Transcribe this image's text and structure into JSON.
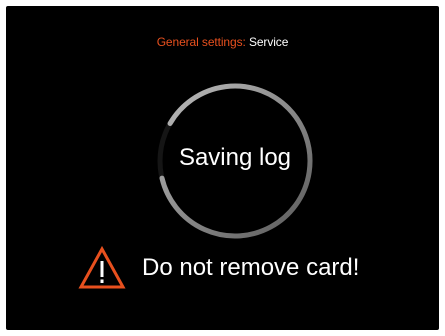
{
  "header": {
    "category": "General settings:",
    "subcategory": "Service"
  },
  "progress": {
    "label": "Saving log",
    "fraction": 0.88
  },
  "warning": {
    "icon": "warning-triangle-icon",
    "text": "Do not remove card!"
  },
  "colors": {
    "background": "#000000",
    "accent": "#e8501e",
    "text": "#ffffff",
    "ring_bright": "#ffffff",
    "ring_dim": "#4a4a4a"
  }
}
